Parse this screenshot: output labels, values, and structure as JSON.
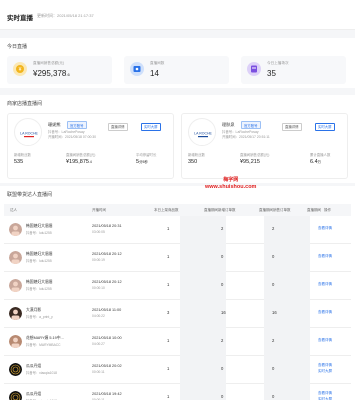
{
  "header": {
    "title": "实时直播",
    "time": "更新时间：2021/05/18 21:17:37"
  },
  "today": {
    "section_title": "今日直播",
    "stats": [
      {
        "label": "直播间销售总额(元)",
        "value": "¥295,378",
        "decimal": ".6",
        "icon": "coin-icon",
        "color": "#f2b51d",
        "bg": "#fbe8b4"
      },
      {
        "label": "直播间数",
        "value": "14",
        "decimal": "",
        "icon": "live-icon",
        "color": "#2a72e8",
        "bg": "#cfe0fb"
      },
      {
        "label": "今日上播场次",
        "value": "35",
        "decimal": "",
        "icon": "calendar-icon",
        "color": "#7b4fe0",
        "bg": "#ddd1f8"
      }
    ]
  },
  "top_rooms": {
    "section_title": "商家店播直播间",
    "rooms": [
      {
        "name": "珊妮熊",
        "tag": "官方账号",
        "account": "抖音号：LaRochePosay",
        "start": "开播时间：2021/05/18 07:00:30",
        "btn_detail": "直播详情",
        "btn_live": "实时大屏",
        "metrics": [
          {
            "label": "新增粉丝数",
            "value": "535",
            "unit": ""
          },
          {
            "label": "直播间销售总额(元)",
            "value": "¥195,875",
            "unit": ".4"
          },
          {
            "label": "平均停留时长",
            "value": "5",
            "unit": "分5秒"
          }
        ]
      },
      {
        "name": "理肤泉",
        "tag": "官方账号",
        "account": "抖音号：LaRochePosay",
        "start": "开播时间：2021/05/17 20:51:11",
        "btn_detail": "直播详情",
        "btn_live": "实时大屏",
        "metrics": [
          {
            "label": "新增粉丝数",
            "value": "350",
            "unit": ""
          },
          {
            "label": "直播间销售总额(元)",
            "value": "¥95,215",
            "unit": ""
          },
          {
            "label": "累计直播人数",
            "value": "6.4",
            "unit": "万"
          }
        ]
      }
    ]
  },
  "table": {
    "section_title": "联盟带货达人直播间",
    "columns": [
      "达人",
      "开播时间",
      "本日上架商品数",
      "直播期间新增订单数",
      "直播期间销售订单数",
      "直播期间",
      "操作"
    ],
    "rows": [
      {
        "name": "韩国媳妇大眉眉",
        "account": "抖音号：lulu1255",
        "start": "2021/05/18 20:31",
        "dur": "03:00:05",
        "c1": "1",
        "c2": "2",
        "c3": "2",
        "op1": "查看详情",
        "op2": ""
      },
      {
        "name": "韩国媳妇大眉眉",
        "account": "抖音号：lulu1255",
        "start": "2021/05/18 20:12",
        "dur": "00:00:19",
        "c1": "1",
        "c2": "0",
        "c3": "0",
        "op1": "查看详情",
        "op2": ""
      },
      {
        "name": "韩国媳妇大眉眉",
        "account": "抖音号：lulu1255",
        "start": "2021/05/18 20:12",
        "dur": "00:00:10",
        "c1": "1",
        "c2": "0",
        "c3": "0",
        "op1": "查看详情",
        "op2": ""
      },
      {
        "name": "大漠月影",
        "account": "抖音号：a_print_y",
        "start": "2021/05/18 11:00",
        "dur": "04:00:22",
        "c1": "3",
        "c2": "16",
        "c3": "16",
        "op1": "查看详情",
        "op2": ""
      },
      {
        "name": "花想MARY姨 5.19中...",
        "account": "抖音号：MARYMBACC",
        "start": "2021/05/18 10:00",
        "dur": "04:00:27",
        "c1": "1",
        "c2": "2",
        "c3": "2",
        "op1": "查看详情",
        "op2": ""
      },
      {
        "name": "瓜瓜丹姐",
        "account": "抖音号：xiaoqia1018",
        "start": "2021/05/18 20:02",
        "dur": "00:00:11",
        "c1": "1",
        "c2": "0",
        "c3": "0",
        "op1": "查看详情",
        "op2": "实时大屏"
      },
      {
        "name": "瓜瓜丹姐",
        "account": "抖音号：xiaoqia1018",
        "start": "2021/05/18 19:42",
        "dur": "00:00:11",
        "c1": "1",
        "c2": "0",
        "c3": "0",
        "op1": "查看详情",
        "op2": "实时大屏"
      }
    ]
  },
  "watermark": {
    "line1": "梅字网",
    "line2": "www.shuishou.com"
  }
}
